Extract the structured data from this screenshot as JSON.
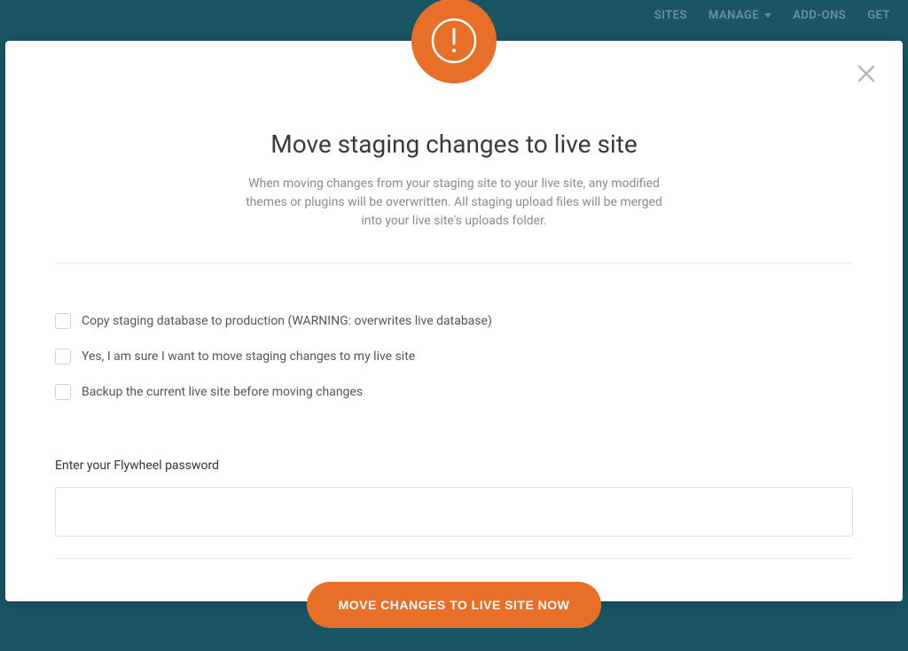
{
  "nav": {
    "items": [
      "SITES",
      "MANAGE",
      "ADD-ONS",
      "GET"
    ]
  },
  "modal": {
    "title": "Move staging changes to live site",
    "subtitle": "When moving changes from your staging site to your live site, any modified themes or plugins will be overwritten. All staging upload files will be merged into your live site's uploads folder.",
    "checkboxes": [
      {
        "label": "Copy staging database to production  (WARNING: overwrites live database)"
      },
      {
        "label": "Yes, I am sure I want to move staging changes to my live site"
      },
      {
        "label": "Backup the current live site before moving changes"
      }
    ],
    "password_label": "Enter your Flywheel password",
    "submit_label": "MOVE CHANGES TO LIVE SITE NOW"
  }
}
